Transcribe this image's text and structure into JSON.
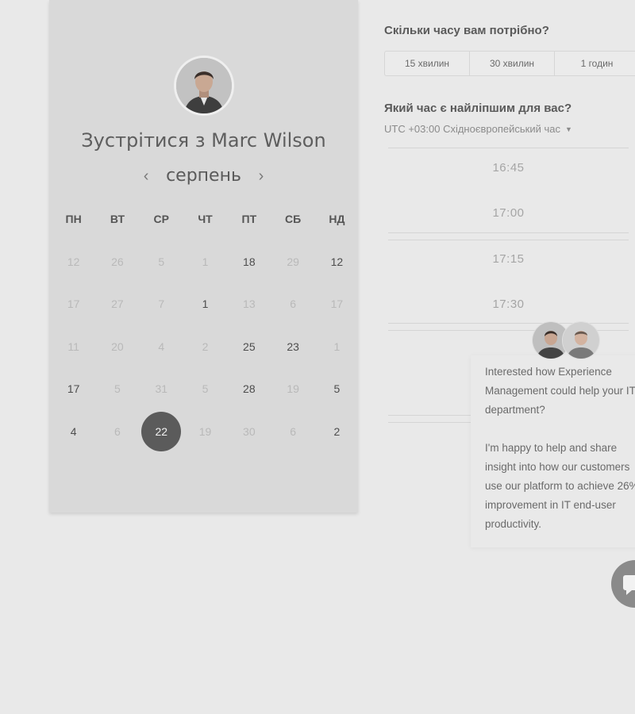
{
  "calendar": {
    "title": "Зустрітися з Marc Wilson",
    "month": "серпень",
    "prev_icon": "chevron-left-icon",
    "next_icon": "chevron-right-icon",
    "weekdays": [
      "ПН",
      "ВТ",
      "СР",
      "ЧТ",
      "ПТ",
      "СБ",
      "НД"
    ],
    "days": [
      {
        "label": "12",
        "state": "muted"
      },
      {
        "label": "26",
        "state": "muted"
      },
      {
        "label": "5",
        "state": "muted"
      },
      {
        "label": "1",
        "state": "muted"
      },
      {
        "label": "18",
        "state": "active"
      },
      {
        "label": "29",
        "state": "muted"
      },
      {
        "label": "12",
        "state": "active"
      },
      {
        "label": "17",
        "state": "muted"
      },
      {
        "label": "27",
        "state": "muted"
      },
      {
        "label": "7",
        "state": "muted"
      },
      {
        "label": "1",
        "state": "active"
      },
      {
        "label": "13",
        "state": "muted"
      },
      {
        "label": "6",
        "state": "muted"
      },
      {
        "label": "17",
        "state": "muted"
      },
      {
        "label": "11",
        "state": "muted"
      },
      {
        "label": "20",
        "state": "muted"
      },
      {
        "label": "4",
        "state": "muted"
      },
      {
        "label": "2",
        "state": "muted"
      },
      {
        "label": "25",
        "state": "active"
      },
      {
        "label": "23",
        "state": "active"
      },
      {
        "label": "1",
        "state": "muted"
      },
      {
        "label": "17",
        "state": "active"
      },
      {
        "label": "5",
        "state": "muted"
      },
      {
        "label": "31",
        "state": "muted"
      },
      {
        "label": "5",
        "state": "muted"
      },
      {
        "label": "28",
        "state": "active"
      },
      {
        "label": "19",
        "state": "muted"
      },
      {
        "label": "5",
        "state": "active"
      },
      {
        "label": "4",
        "state": "active"
      },
      {
        "label": "6",
        "state": "muted"
      },
      {
        "label": "22",
        "state": "selected"
      },
      {
        "label": "19",
        "state": "muted"
      },
      {
        "label": "30",
        "state": "muted"
      },
      {
        "label": "6",
        "state": "muted"
      },
      {
        "label": "2",
        "state": "active"
      }
    ]
  },
  "duration": {
    "question": "Скільки часу вам потрібно?",
    "options": [
      "15 хвилин",
      "30 хвилин",
      "1 годин"
    ]
  },
  "time": {
    "question": "Який час є найліпшим для вас?",
    "timezone": "UTC +03:00 Східноєвропейський час",
    "timezone_caret_icon": "caret-down-icon",
    "slots": [
      "16:45",
      "17:00",
      "17:15",
      "17:30"
    ]
  },
  "chat": {
    "message": "Interested how Experience Management could help your IT department?\n\nI'm happy to help and share insight into how our customers use our platform to achieve 26% improvement in IT end-user productivity.",
    "launcher_icon": "chat-icon"
  }
}
